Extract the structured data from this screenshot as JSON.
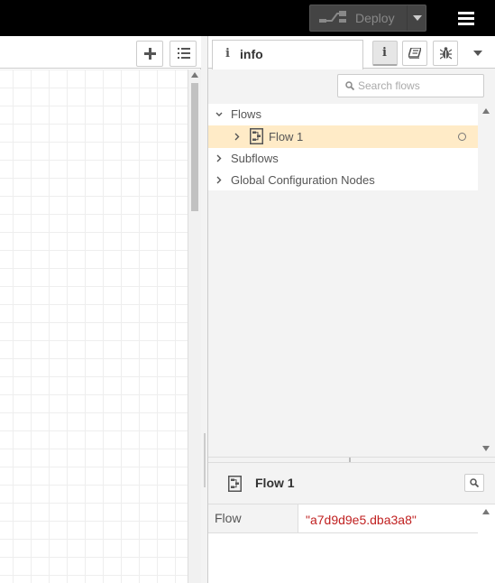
{
  "header": {
    "deploy_label": "Deploy"
  },
  "sidebar": {
    "tab_label": "info",
    "search_placeholder": "Search flows",
    "tree": {
      "flows_label": "Flows",
      "flow_item": "Flow 1",
      "subflows_label": "Subflows",
      "global_config_label": "Global Configuration Nodes"
    },
    "help": {
      "title": "Flow 1",
      "property_key": "Flow",
      "property_value": "\"a7d9d9e5.dba3a8\""
    }
  },
  "colors": {
    "header_bg": "#000000",
    "selected_row": "#ffebc7",
    "value_text": "#c02020"
  }
}
